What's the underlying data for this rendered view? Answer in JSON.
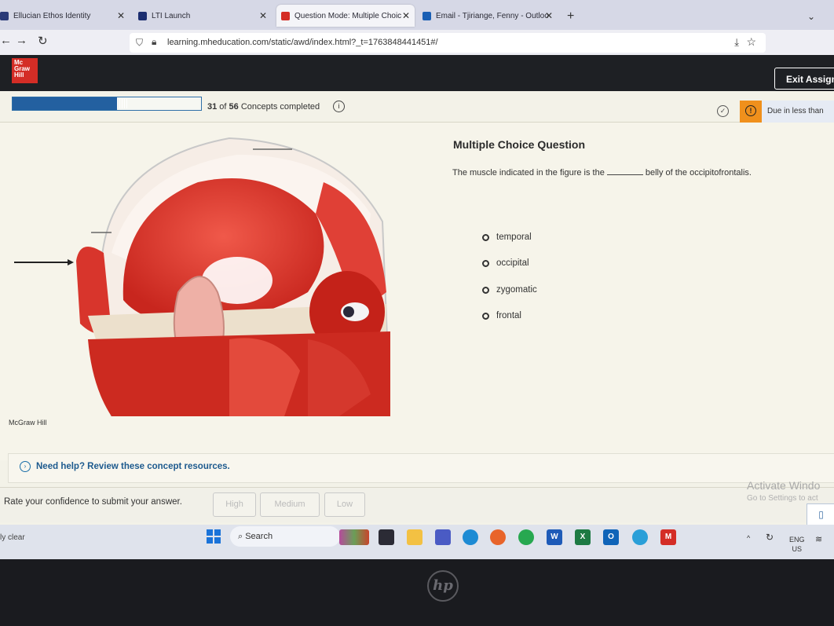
{
  "browser": {
    "tabs": [
      {
        "label": "Ellucian Ethos Identity",
        "active": false
      },
      {
        "label": "LTI Launch",
        "active": false
      },
      {
        "label": "Question Mode: Multiple Choic",
        "active": true
      },
      {
        "label": "Email - Tjiriange, Fenny - Outloo",
        "active": false
      }
    ],
    "new_tab": "+",
    "url": "learning.mheducation.com/static/awd/index.html?_t=1763848441451#/"
  },
  "header": {
    "logo_lines": [
      "Mc",
      "Graw",
      "Hill"
    ],
    "exit_label": "Exit Assign"
  },
  "progress": {
    "completed": "31",
    "total": "56",
    "of": " of ",
    "suffix": " Concepts completed",
    "fraction": 0.553,
    "due_text": "Due in less than"
  },
  "question": {
    "title": "Multiple Choice Question",
    "text_before": "The muscle indicated in the figure is the",
    "text_after": "belly of the occipitofrontalis.",
    "options": [
      "temporal",
      "occipital",
      "zygomatic",
      "frontal"
    ]
  },
  "figure": {
    "credit": "McGraw Hill"
  },
  "help": {
    "label": "Need help? Review these concept resources."
  },
  "confidence": {
    "prompt": "Rate your confidence to submit your answer.",
    "buttons": [
      "High",
      "Medium",
      "Low"
    ]
  },
  "windows_notice": {
    "line1": "Activate Windo",
    "line2": "Go to Settings to act"
  },
  "taskbar": {
    "weather": "ly clear",
    "search_placeholder": "Search",
    "lang1": "ENG",
    "lang2": "US"
  },
  "colors": {
    "brand_red": "#d42d26",
    "progress_blue": "#2360a0",
    "warning_orange": "#f0901c",
    "help_blue": "#1d5a8e"
  }
}
